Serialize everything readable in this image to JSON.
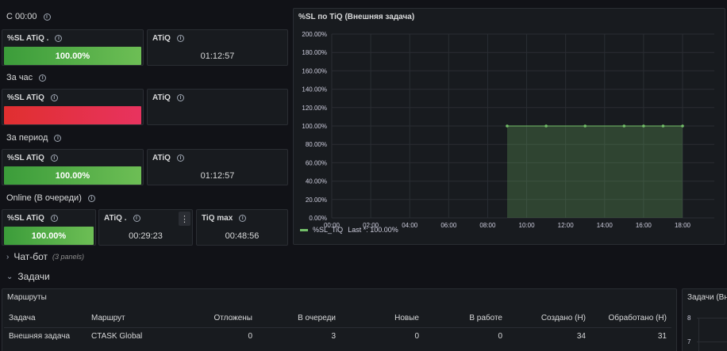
{
  "rows": {
    "since_midnight": "С 00:00",
    "per_hour": "За час",
    "per_period": "За период",
    "online": "Online (В очереди)"
  },
  "stats": {
    "r1_sl": {
      "title": "%SL ATiQ .",
      "value": "100.00%"
    },
    "r1_atiq": {
      "title": "ATiQ",
      "value": "01:12:57"
    },
    "r2_sl": {
      "title": "%SL ATiQ",
      "value": ""
    },
    "r2_atiq": {
      "title": "ATiQ",
      "value": ""
    },
    "r3_sl": {
      "title": "%SL ATiQ",
      "value": "100.00%"
    },
    "r3_atiq": {
      "title": "ATiQ",
      "value": "01:12:57"
    },
    "r4_sl": {
      "title": "%SL ATiQ",
      "value": "100.00%"
    },
    "r4_atiq": {
      "title": "ATiQ .",
      "value": "00:29:23"
    },
    "r4_tiqmax": {
      "title": "TiQ max",
      "value": "00:48:56"
    }
  },
  "colors": {
    "ok": "#73bf69",
    "bad": "#e02f2f",
    "panel": "#181b1f"
  },
  "chart_panel": {
    "title": "%SL по TiQ (Внешняя задача)",
    "legend_series": "%SL_TiQ",
    "legend_last": "Last *: 100.00%"
  },
  "chart_data": {
    "type": "area",
    "title": "%SL по TiQ (Внешняя задача)",
    "y_ticks": [
      "200.00%",
      "180.00%",
      "160.00%",
      "140.00%",
      "120.00%",
      "100.00%",
      "80.00%",
      "60.00%",
      "40.00%",
      "20.00%",
      "0.00%"
    ],
    "x_ticks": [
      "00:00",
      "02:00",
      "04:00",
      "06:00",
      "08:00",
      "10:00",
      "12:00",
      "14:00",
      "16:00",
      "18:00"
    ],
    "ylim": [
      0,
      200
    ],
    "xlim": [
      "00:00",
      "18:00"
    ],
    "series": [
      {
        "name": "%SL_TiQ",
        "color": "#73bf69",
        "x": [
          "09:00",
          "11:00",
          "13:00",
          "15:00",
          "16:00",
          "17:00",
          "18:00"
        ],
        "y": [
          100,
          100,
          100,
          100,
          100,
          100,
          100
        ]
      }
    ],
    "grid": true,
    "legend": "bottom-left"
  },
  "sections": {
    "chatbot": {
      "label": "Чат-бот",
      "sub": "(3 panels)"
    },
    "tasks": {
      "label": "Задачи"
    }
  },
  "routes_panel": {
    "title": "Маршруты",
    "columns": [
      "Задача",
      "Маршрут",
      "Отложены",
      "В очереди",
      "Новые",
      "В работе",
      "Создано (Н)",
      "Обработано (Н)"
    ],
    "rows": [
      [
        "Внешняя задача",
        "CTASK Global",
        "0",
        "3",
        "0",
        "0",
        "34",
        "31"
      ]
    ]
  },
  "tasks_panel": {
    "title": "Задачи (Вне",
    "y_ticks": [
      "8",
      "7"
    ]
  }
}
